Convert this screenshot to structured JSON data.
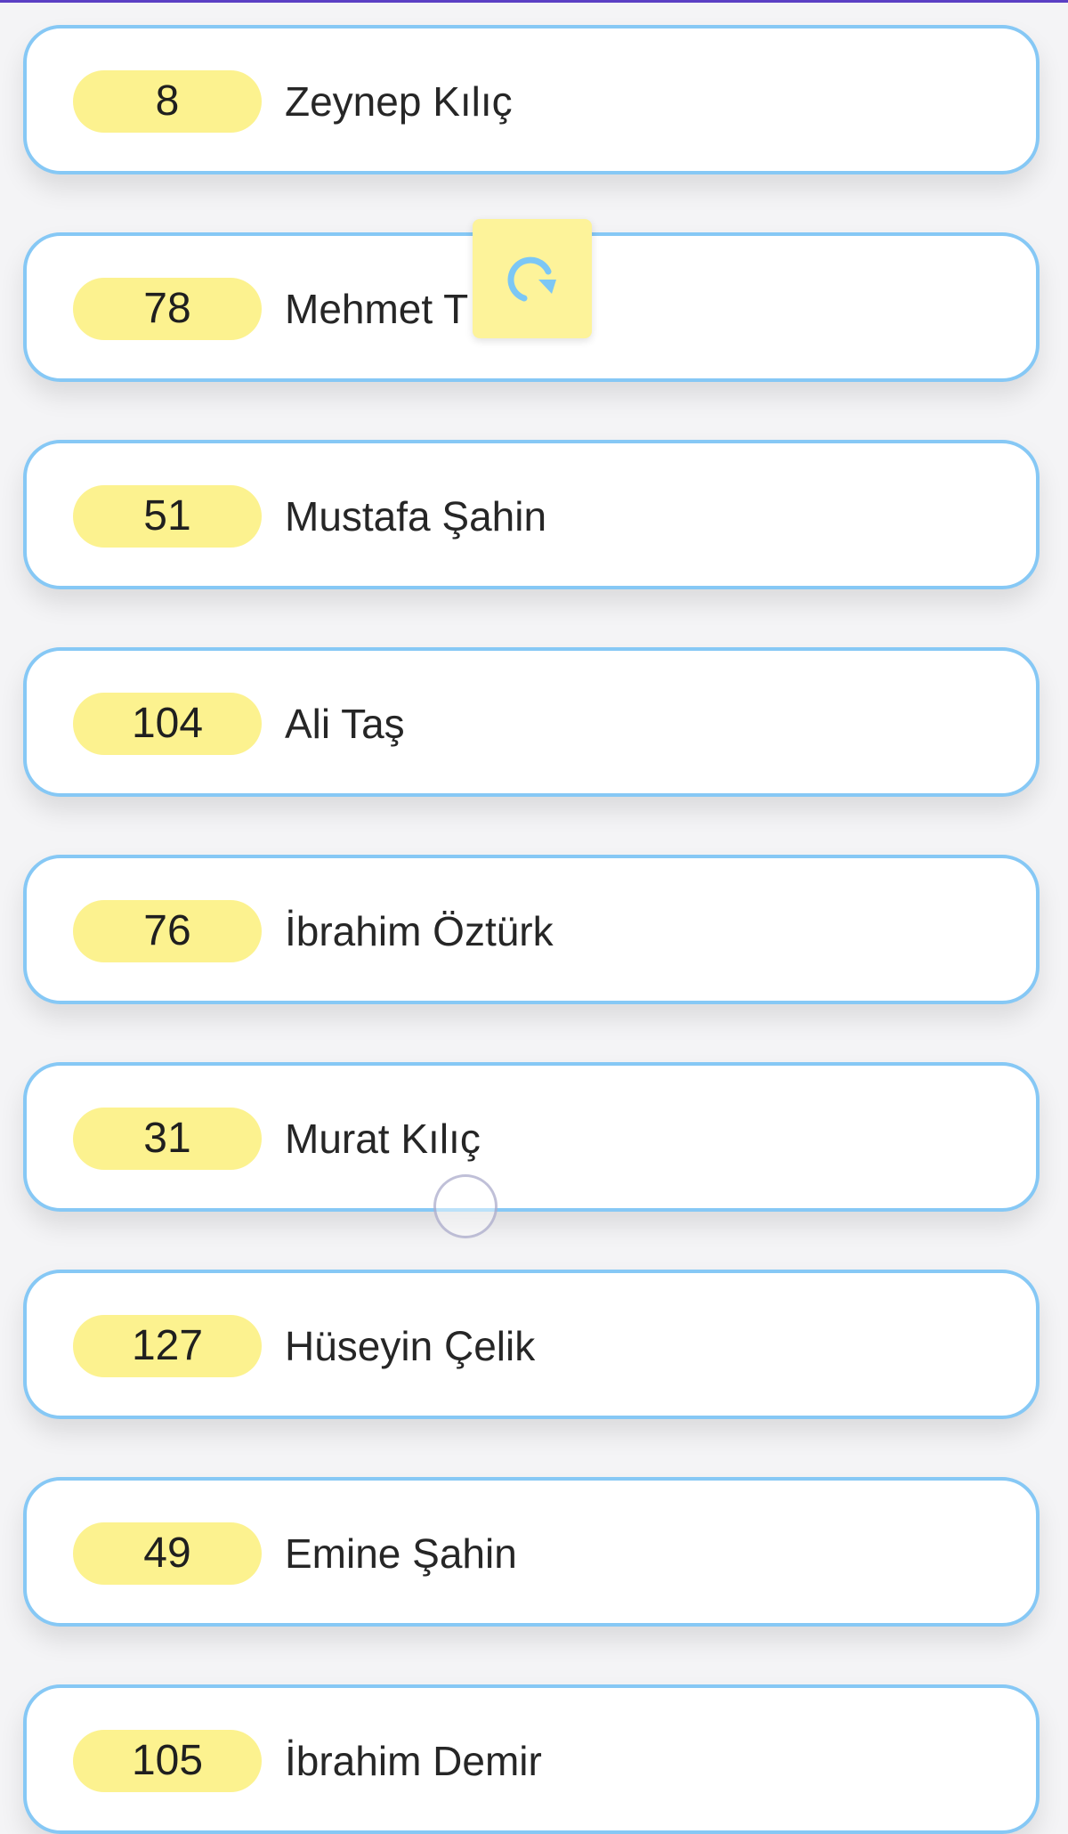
{
  "refresh": {
    "icon": "refresh-icon",
    "background_color": "#fdf39a",
    "icon_color": "#7cc7f5"
  },
  "colors": {
    "card_border": "#86c8f5",
    "badge_background": "#fcf28f",
    "top_bar": "#5b3fc4"
  },
  "items": [
    {
      "number": "8",
      "name": "Zeynep Kılıç"
    },
    {
      "number": "78",
      "name": "Mehmet T"
    },
    {
      "number": "51",
      "name": "Mustafa Şahin"
    },
    {
      "number": "104",
      "name": "Ali Taş"
    },
    {
      "number": "76",
      "name": "İbrahim Öztürk"
    },
    {
      "number": "31",
      "name": "Murat Kılıç"
    },
    {
      "number": "127",
      "name": "Hüseyin Çelik"
    },
    {
      "number": "49",
      "name": "Emine Şahin"
    },
    {
      "number": "105",
      "name": "İbrahim Demir"
    }
  ]
}
